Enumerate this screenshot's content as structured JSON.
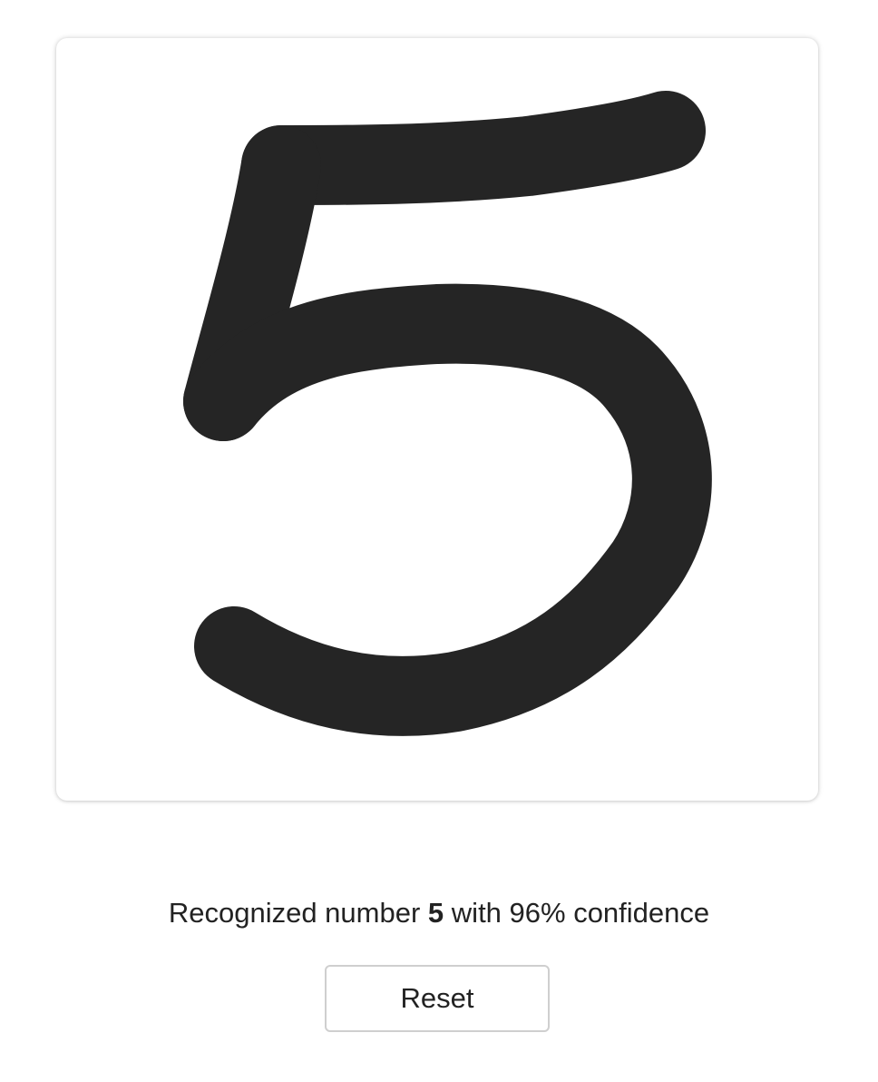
{
  "drawing_canvas": {
    "stroke_color": "#252525",
    "background_color": "#ffffff"
  },
  "result": {
    "prefix": "Recognized number",
    "digit": "5",
    "suffix": "with 96% confidence"
  },
  "controls": {
    "reset_label": "Reset"
  }
}
